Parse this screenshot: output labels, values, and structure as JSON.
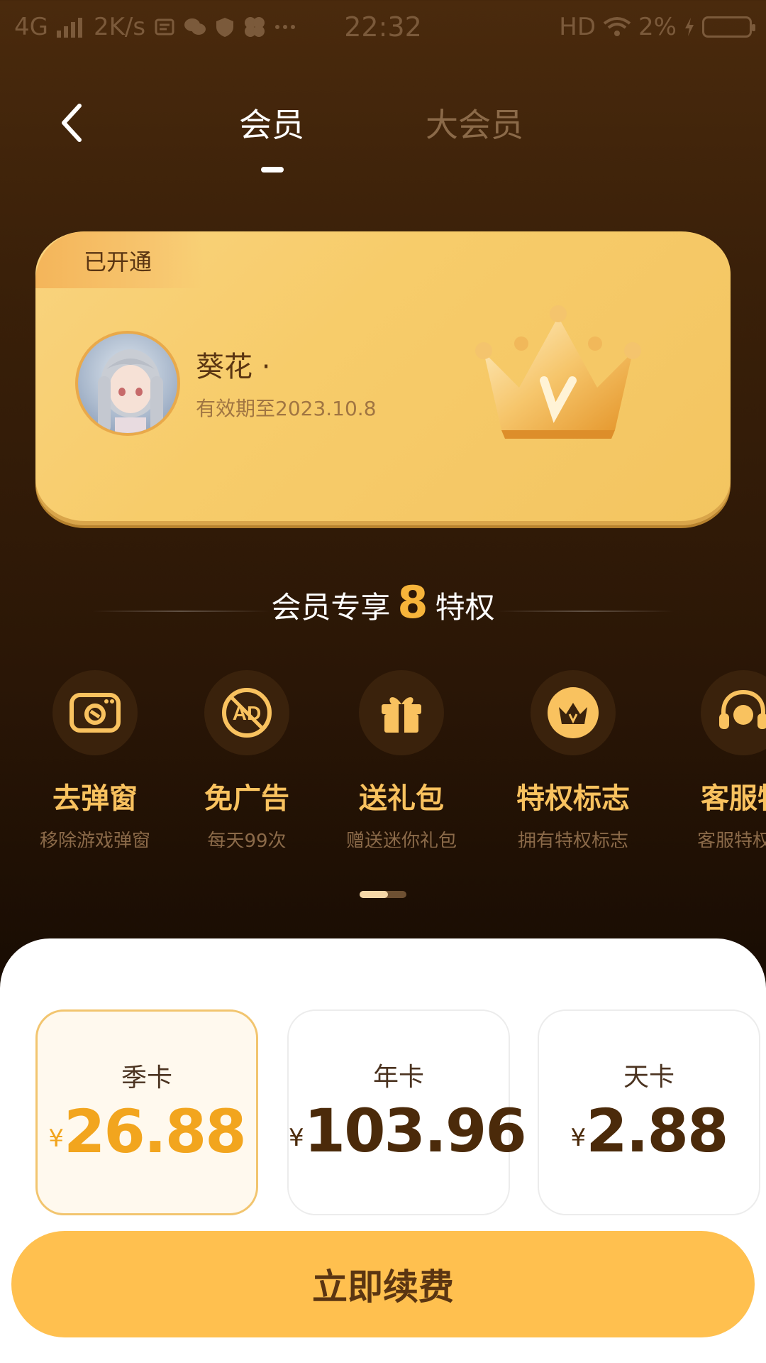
{
  "status_bar": {
    "network": "4G",
    "speed": "2K/s",
    "time": "22:32",
    "hd": "HD",
    "battery_pct": "2%",
    "icons": [
      "signal-icon",
      "speed-icon",
      "notif-icon",
      "wechat-icon",
      "shield-icon",
      "app-icon",
      "more-icon",
      "wifi-icon",
      "charging-icon",
      "battery-icon"
    ]
  },
  "header": {
    "tabs": [
      {
        "label": "会员",
        "active": true
      },
      {
        "label": "大会员",
        "active": false
      }
    ]
  },
  "card": {
    "badge": "已开通",
    "user_name": "葵花 ·",
    "expiry": "有效期至2023.10.8",
    "colors": {
      "card": "#f7cc6a",
      "badge": "#f4b55a"
    }
  },
  "privileges": {
    "title_prefix": "会员专享",
    "count": "8",
    "title_suffix": "特权",
    "items": [
      {
        "title": "去弹窗",
        "subtitle": "移除游戏弹窗",
        "icon": "popup-window-icon"
      },
      {
        "title": "免广告",
        "subtitle": "每天99次",
        "icon": "no-ad-icon"
      },
      {
        "title": "送礼包",
        "subtitle": "赠送迷你礼包",
        "icon": "gift-icon"
      },
      {
        "title": "特权标志",
        "subtitle": "拥有特权标志",
        "icon": "crown-badge-icon"
      },
      {
        "title": "客服特",
        "subtitle": "客服特权通",
        "icon": "headset-icon"
      }
    ]
  },
  "plans": [
    {
      "name": "季卡",
      "currency": "¥",
      "price": "26.88",
      "selected": true
    },
    {
      "name": "年卡",
      "currency": "¥",
      "price": "103.96",
      "selected": false
    },
    {
      "name": "天卡",
      "currency": "¥",
      "price": "2.88",
      "selected": false
    }
  ],
  "cta": {
    "label": "立即续费"
  },
  "colors": {
    "accent": "#ffc04f",
    "gold_text": "#f9c25f",
    "price_selected": "#f2a51e"
  }
}
